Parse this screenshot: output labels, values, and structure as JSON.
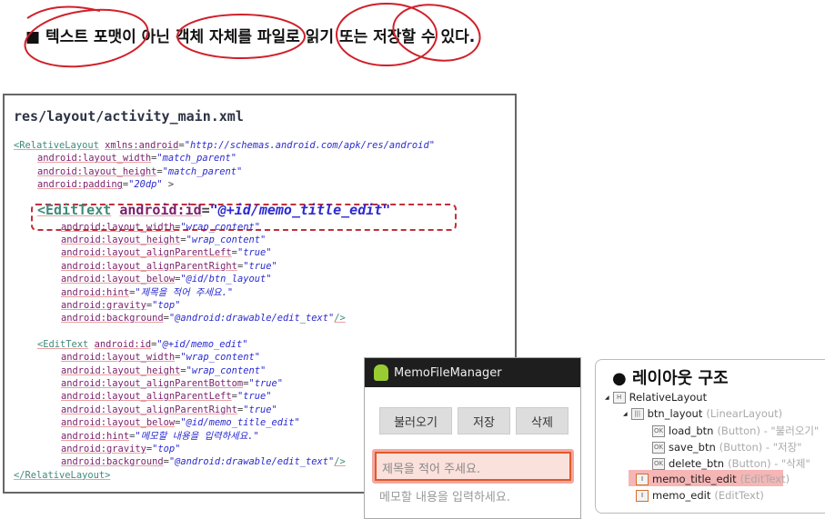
{
  "heading": "■ 텍스트 포맷이 아닌 객체 자체를 파일로 읽기 또는 저장할 수 있다.",
  "colors": {
    "annotation": "#d0202a",
    "tag": "#3f8a7a",
    "attr": "#7a1f6a",
    "value": "#2a2ad0"
  },
  "code": {
    "file": "res/layout/activity_main.xml",
    "lines": [
      {
        "i": 0,
        "p": [
          [
            "tag",
            "<RelativeLayout"
          ],
          [
            "p",
            " "
          ],
          [
            "attr",
            "xmlns:android"
          ],
          [
            "p",
            "="
          ],
          [
            "val",
            "\"http://schemas.android.com/apk/res/android\""
          ]
        ]
      },
      {
        "i": 1,
        "p": [
          [
            "attr",
            "android:layout_width"
          ],
          [
            "p",
            "="
          ],
          [
            "val",
            "\"match_parent\""
          ]
        ]
      },
      {
        "i": 1,
        "p": [
          [
            "attr",
            "android:layout_height"
          ],
          [
            "p",
            "="
          ],
          [
            "val",
            "\"match_parent\""
          ]
        ]
      },
      {
        "i": 1,
        "p": [
          [
            "attr",
            "android:padding"
          ],
          [
            "p",
            "="
          ],
          [
            "val",
            "\"20dp\""
          ],
          [
            "p",
            " >"
          ]
        ]
      },
      {
        "i": 0,
        "big": true,
        "p": [
          [
            "tag",
            "<EditText"
          ],
          [
            "p",
            " "
          ],
          [
            "attr",
            "android:id"
          ],
          [
            "p",
            "="
          ],
          [
            "val",
            "\"@+id/memo_title_edit\""
          ]
        ]
      },
      {
        "i": 2,
        "p": [
          [
            "attr",
            "android:layout_width"
          ],
          [
            "p",
            "="
          ],
          [
            "val",
            "\"wrap_content\""
          ]
        ]
      },
      {
        "i": 2,
        "p": [
          [
            "attr",
            "android:layout_height"
          ],
          [
            "p",
            "="
          ],
          [
            "val",
            "\"wrap_content\""
          ]
        ]
      },
      {
        "i": 2,
        "p": [
          [
            "attr",
            "android:layout_alignParentLeft"
          ],
          [
            "p",
            "="
          ],
          [
            "val",
            "\"true\""
          ]
        ]
      },
      {
        "i": 2,
        "p": [
          [
            "attr",
            "android:layout_alignParentRight"
          ],
          [
            "p",
            "="
          ],
          [
            "val",
            "\"true\""
          ]
        ]
      },
      {
        "i": 2,
        "p": [
          [
            "attr",
            "android:layout_below"
          ],
          [
            "p",
            "="
          ],
          [
            "val",
            "\"@id/btn_layout\""
          ]
        ]
      },
      {
        "i": 2,
        "p": [
          [
            "attr",
            "android:hint"
          ],
          [
            "p",
            "="
          ],
          [
            "val",
            "\"제목을 적어 주세요.\""
          ]
        ]
      },
      {
        "i": 2,
        "p": [
          [
            "attr",
            "android:gravity"
          ],
          [
            "p",
            "="
          ],
          [
            "val",
            "\"top\""
          ]
        ]
      },
      {
        "i": 2,
        "p": [
          [
            "attr",
            "android:background"
          ],
          [
            "p",
            "="
          ],
          [
            "val",
            "\"@android:drawable/edit_text\""
          ],
          [
            "tag",
            "/>"
          ]
        ]
      },
      {
        "i": 1,
        "p": [
          [
            "tag",
            "<EditText"
          ],
          [
            "p",
            " "
          ],
          [
            "attr",
            "android:id"
          ],
          [
            "p",
            "="
          ],
          [
            "val",
            "\"@+id/memo_edit\""
          ]
        ]
      },
      {
        "i": 2,
        "p": [
          [
            "attr",
            "android:layout_width"
          ],
          [
            "p",
            "="
          ],
          [
            "val",
            "\"wrap_content\""
          ]
        ]
      },
      {
        "i": 2,
        "p": [
          [
            "attr",
            "android:layout_height"
          ],
          [
            "p",
            "="
          ],
          [
            "val",
            "\"wrap_content\""
          ]
        ]
      },
      {
        "i": 2,
        "p": [
          [
            "attr",
            "android:layout_alignParentBottom"
          ],
          [
            "p",
            "="
          ],
          [
            "val",
            "\"true\""
          ]
        ]
      },
      {
        "i": 2,
        "p": [
          [
            "attr",
            "android:layout_alignParentLeft"
          ],
          [
            "p",
            "="
          ],
          [
            "val",
            "\"true\""
          ]
        ]
      },
      {
        "i": 2,
        "p": [
          [
            "attr",
            "android:layout_alignParentRight"
          ],
          [
            "p",
            "="
          ],
          [
            "val",
            "\"true\""
          ]
        ]
      },
      {
        "i": 2,
        "p": [
          [
            "attr",
            "android:layout_below"
          ],
          [
            "p",
            "="
          ],
          [
            "val",
            "\"@id/memo_title_edit\""
          ]
        ]
      },
      {
        "i": 2,
        "p": [
          [
            "attr",
            "android:hint"
          ],
          [
            "p",
            "="
          ],
          [
            "val",
            "\"메모할 내용을 입력하세요.\""
          ]
        ]
      },
      {
        "i": 2,
        "p": [
          [
            "attr",
            "android:gravity"
          ],
          [
            "p",
            "="
          ],
          [
            "val",
            "\"top\""
          ]
        ]
      },
      {
        "i": 2,
        "p": [
          [
            "attr",
            "android:background"
          ],
          [
            "p",
            "="
          ],
          [
            "val",
            "\"@android:drawable/edit_text\""
          ],
          [
            "tag",
            "/>"
          ]
        ]
      },
      {
        "i": 0,
        "p": [
          [
            "tag",
            "</RelativeLayout>"
          ]
        ]
      }
    ]
  },
  "phone": {
    "title": "MemoFileManager",
    "buttons": [
      "불러오기",
      "저장",
      "삭제"
    ],
    "title_hint": "제목을 적어 주세요.",
    "memo_hint": "메모할 내용을 입력하세요."
  },
  "tree": {
    "title": "● 레이아웃 구조",
    "items": [
      {
        "name": "RelativeLayout",
        "kind": "",
        "icon": "relative-layout-icon"
      },
      {
        "name": "btn_layout",
        "kind": "(LinearLayout)",
        "icon": "linear-layout-icon"
      },
      {
        "name": "load_btn",
        "kind": "(Button) - \"불러오기\"",
        "icon": "button-icon"
      },
      {
        "name": "save_btn",
        "kind": "(Button) - \"저장\"",
        "icon": "button-icon"
      },
      {
        "name": "delete_btn",
        "kind": "(Button) - \"삭제\"",
        "icon": "button-icon"
      },
      {
        "name": "memo_title_edit",
        "kind": "(EditText)",
        "icon": "edittext-icon"
      },
      {
        "name": "memo_edit",
        "kind": "(EditText)",
        "icon": "edittext-icon"
      }
    ]
  }
}
